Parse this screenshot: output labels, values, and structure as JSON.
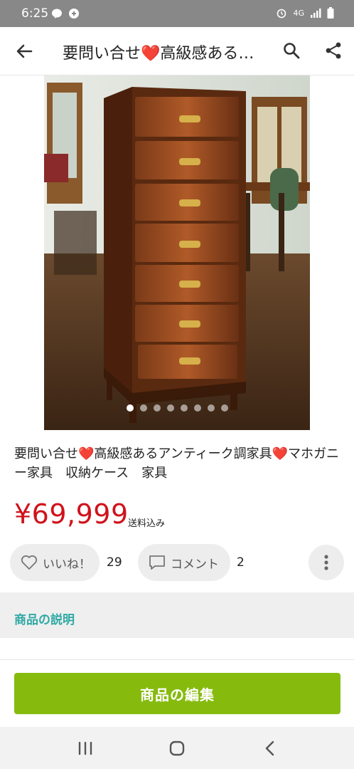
{
  "status_bar": {
    "time": "6:25",
    "network": "4G"
  },
  "app_bar": {
    "title": "要問い合せ❤️高級感ある…",
    "back_icon": "arrow-left-icon",
    "search_icon": "search-icon",
    "share_icon": "share-icon"
  },
  "gallery": {
    "image_count": 8,
    "active_index": 0
  },
  "product": {
    "title": "要問い合せ❤️高級感あるアンティーク調家具❤️マホガニー家具　収納ケース　家具",
    "price": "¥69,999",
    "shipping": "送料込み"
  },
  "actions": {
    "like_label": "いいね！",
    "like_count": "29",
    "comment_label": "コメント",
    "comment_count": "2"
  },
  "section": {
    "description_title": "商品の説明"
  },
  "bottom": {
    "edit_label": "商品の編集"
  },
  "colors": {
    "price": "#d0121b",
    "accent_green": "#86bb0e",
    "section_teal": "#2fa9a4"
  }
}
